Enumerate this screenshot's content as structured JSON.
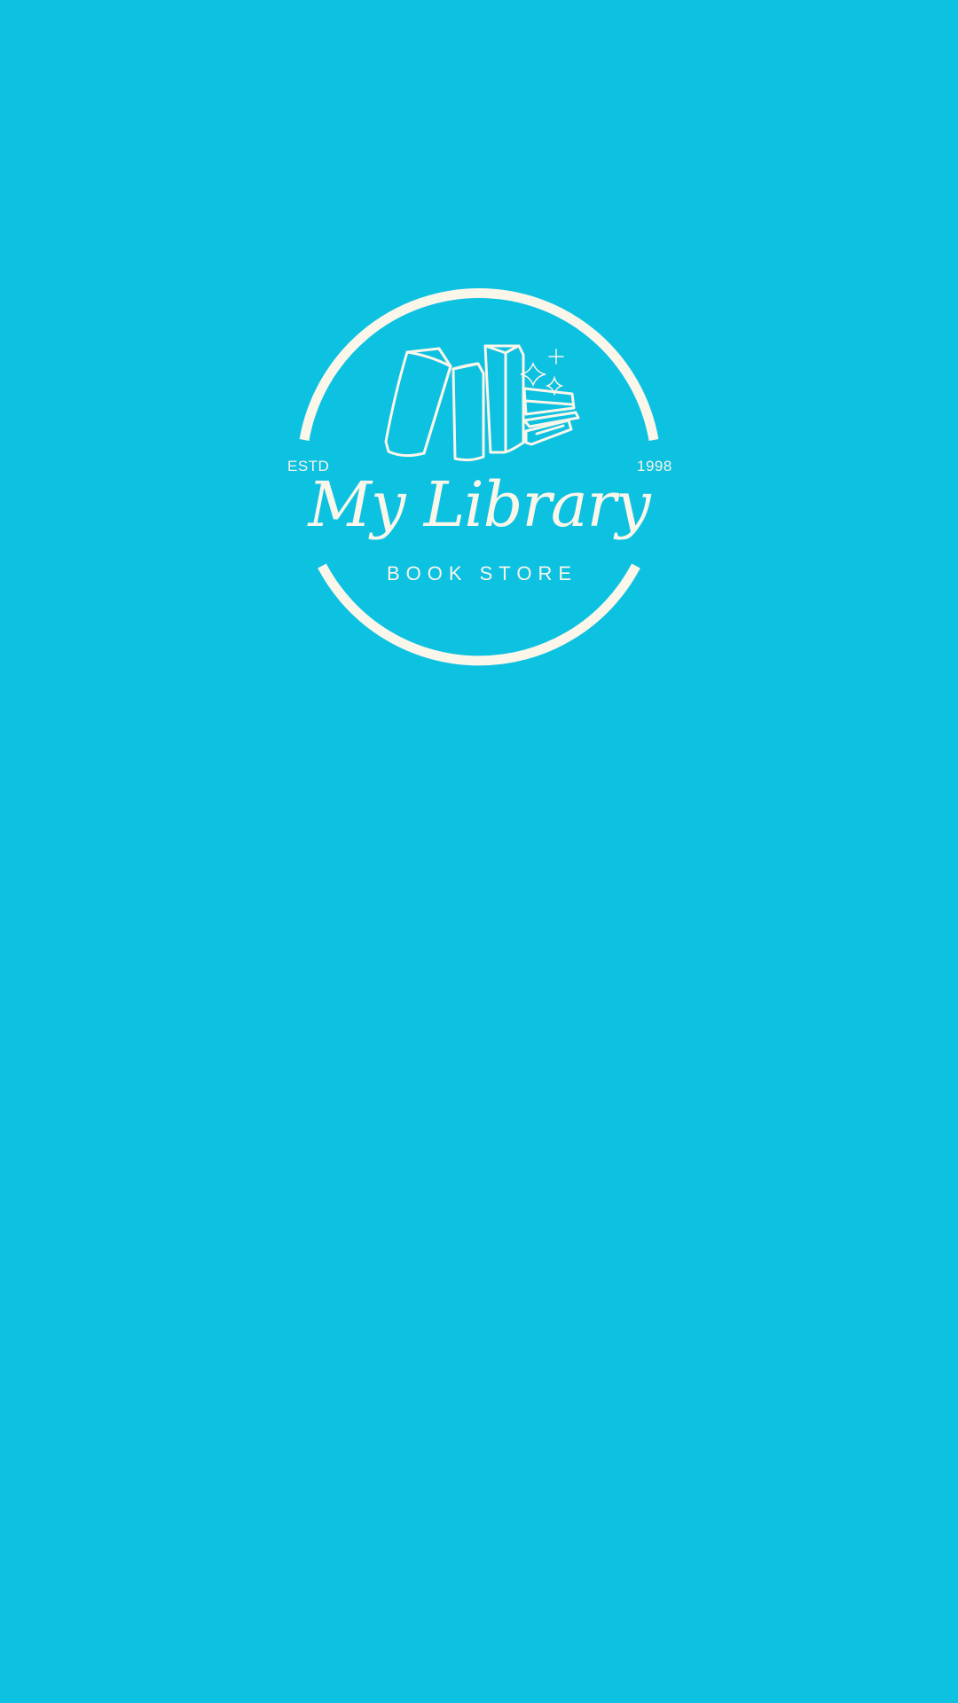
{
  "logo": {
    "estd_label": "ESTD",
    "year": "1998",
    "title": "My Library",
    "subtitle": "BOOK STORE",
    "icon": "books-stack-icon"
  },
  "colors": {
    "background": "#0dc1e1",
    "foreground": "#faf6ea"
  }
}
